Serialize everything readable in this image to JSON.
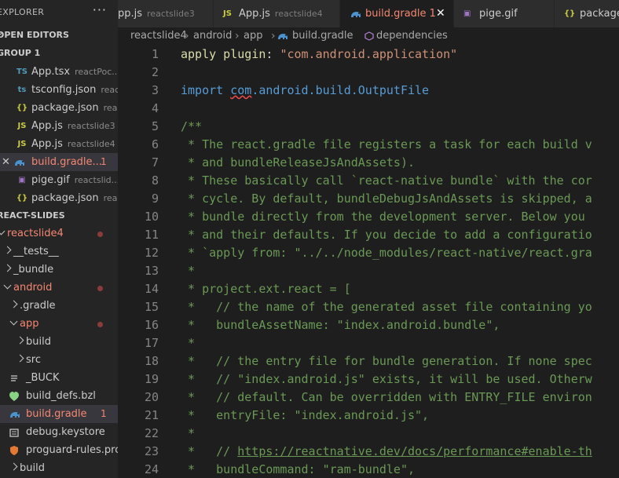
{
  "explorer": {
    "title": "EXPLORER",
    "more": "···",
    "open_editors_title": "OPEN EDITORS",
    "group_title": "GROUP 1",
    "open_editors": [
      {
        "label": "App.tsx",
        "desc": "reactPoc...",
        "icon": "typescript-icon",
        "glyph": "TS",
        "color": "#519aba"
      },
      {
        "label": "tsconfig.json",
        "desc": "reac...",
        "icon": "tsconfig-icon",
        "glyph": "ts",
        "color": "#519aba"
      },
      {
        "label": "package.json",
        "desc": "rea...",
        "icon": "json-icon",
        "glyph": "{}",
        "color": "#cbcb41"
      },
      {
        "label": "App.js",
        "desc": "reactslide3",
        "icon": "javascript-icon",
        "glyph": "JS",
        "color": "#cbcb41"
      },
      {
        "label": "App.js",
        "desc": "reactslide4",
        "icon": "javascript-icon",
        "glyph": "JS",
        "color": "#cbcb41"
      },
      {
        "label": "build.gradle...",
        "desc": "",
        "badge": "1",
        "icon": "gradle-icon",
        "glyph": "",
        "color": "#4c92cf",
        "active": true,
        "error": true
      },
      {
        "label": "pige.gif",
        "desc": "reactslid...",
        "icon": "image-icon",
        "glyph": "▣",
        "color": "#a074c4"
      },
      {
        "label": "package.json",
        "desc": "rea...",
        "icon": "json-icon",
        "glyph": "{}",
        "color": "#cbcb41"
      }
    ],
    "project_title": "REACT-SLIDES",
    "tree": [
      {
        "label": "reactslide4",
        "type": "folder",
        "open": true,
        "depth": 0,
        "error": true,
        "dot": true
      },
      {
        "label": "__tests__",
        "type": "folder",
        "open": false,
        "depth": 1
      },
      {
        "label": "_bundle",
        "type": "folder",
        "open": false,
        "depth": 1
      },
      {
        "label": "android",
        "type": "folder",
        "open": true,
        "depth": 1,
        "error": true,
        "dot": true
      },
      {
        "label": ".gradle",
        "type": "folder",
        "open": false,
        "depth": 2
      },
      {
        "label": "app",
        "type": "folder",
        "open": true,
        "depth": 2,
        "error": true,
        "dot": true
      },
      {
        "label": "build",
        "type": "folder",
        "open": false,
        "depth": 3
      },
      {
        "label": "src",
        "type": "folder",
        "open": false,
        "depth": 3
      },
      {
        "label": "_BUCK",
        "type": "file",
        "icon": "file-icon",
        "depth": 3
      },
      {
        "label": "build_defs.bzl",
        "type": "file",
        "icon": "bazel-icon",
        "depth": 3
      },
      {
        "label": "build.gradle",
        "type": "file",
        "icon": "gradle-icon",
        "depth": 3,
        "badge": "1",
        "active": true,
        "error": true
      },
      {
        "label": "debug.keystore",
        "type": "file",
        "icon": "keystore-icon",
        "depth": 3
      },
      {
        "label": "proguard-rules.pro",
        "type": "file",
        "icon": "proguard-icon",
        "depth": 3
      },
      {
        "label": "build",
        "type": "folder",
        "open": false,
        "depth": 2
      }
    ]
  },
  "tabs": [
    {
      "label": "App.js",
      "desc": "reactslide3",
      "icon": "javascript-icon",
      "glyph": "JS",
      "color": "#cbcb41",
      "partial_label": "pp.js"
    },
    {
      "label": "App.js",
      "desc": "reactslide4",
      "icon": "javascript-icon",
      "glyph": "JS",
      "color": "#cbcb41"
    },
    {
      "label": "build.gradle 1",
      "desc": "",
      "icon": "gradle-icon",
      "active": true,
      "close": "✕"
    },
    {
      "label": "pige.gif",
      "desc": "",
      "icon": "image-icon",
      "glyph": "▣",
      "color": "#a074c4"
    },
    {
      "label": "package.",
      "desc": "",
      "icon": "json-icon",
      "glyph": "{}",
      "color": "#cbcb41"
    }
  ],
  "breadcrumb": [
    "reactslide4",
    "android",
    "app",
    "build.gradle",
    "dependencies"
  ],
  "editor": {
    "lines": [
      {
        "n": 1,
        "tokens": [
          {
            "t": "apply plugin",
            "c": "id"
          },
          {
            "t": ": ",
            "c": "pl"
          },
          {
            "t": "\"com.android.application\"",
            "c": "str"
          }
        ]
      },
      {
        "n": 2,
        "tokens": []
      },
      {
        "n": 3,
        "tokens": [
          {
            "t": "import ",
            "c": "kw"
          },
          {
            "t": "com",
            "c": "kw squig"
          },
          {
            "t": ".android.build.OutputFile",
            "c": "kw"
          }
        ]
      },
      {
        "n": 4,
        "tokens": []
      },
      {
        "n": 5,
        "tokens": [
          {
            "t": "/**",
            "c": "cm"
          }
        ]
      },
      {
        "n": 6,
        "tokens": [
          {
            "t": " * The react.gradle file registers a task for each build v",
            "c": "cm"
          }
        ]
      },
      {
        "n": 7,
        "tokens": [
          {
            "t": " * and bundleReleaseJsAndAssets).",
            "c": "cm"
          }
        ]
      },
      {
        "n": 8,
        "tokens": [
          {
            "t": " * These basically call `react-native bundle` with the cor",
            "c": "cm"
          }
        ]
      },
      {
        "n": 9,
        "tokens": [
          {
            "t": " * cycle. By default, bundleDebugJsAndAssets is skipped, a",
            "c": "cm"
          }
        ]
      },
      {
        "n": 10,
        "tokens": [
          {
            "t": " * bundle directly from the development server. Below you ",
            "c": "cm"
          }
        ]
      },
      {
        "n": 11,
        "tokens": [
          {
            "t": " * and their defaults. If you decide to add a configuratio",
            "c": "cm"
          }
        ]
      },
      {
        "n": 12,
        "tokens": [
          {
            "t": " * `apply from: \"../../node_modules/react-native/react.gra",
            "c": "cm"
          }
        ]
      },
      {
        "n": 13,
        "tokens": [
          {
            "t": " *",
            "c": "cm"
          }
        ]
      },
      {
        "n": 14,
        "tokens": [
          {
            "t": " * project.ext.react = [",
            "c": "cm"
          }
        ]
      },
      {
        "n": 15,
        "tokens": [
          {
            "t": " *   // the name of the generated asset file containing yo",
            "c": "cm"
          }
        ]
      },
      {
        "n": 16,
        "tokens": [
          {
            "t": " *   bundleAssetName: \"index.android.bundle\",",
            "c": "cm"
          }
        ]
      },
      {
        "n": 17,
        "tokens": [
          {
            "t": " *",
            "c": "cm"
          }
        ]
      },
      {
        "n": 18,
        "tokens": [
          {
            "t": " *   // the entry file for bundle generation. If none spec",
            "c": "cm"
          }
        ]
      },
      {
        "n": 19,
        "tokens": [
          {
            "t": " *   // \"index.android.js\" exists, it will be used. Otherw",
            "c": "cm"
          }
        ]
      },
      {
        "n": 20,
        "tokens": [
          {
            "t": " *   // default. Can be overridden with ENTRY_FILE environ",
            "c": "cm"
          }
        ]
      },
      {
        "n": 21,
        "tokens": [
          {
            "t": " *   entryFile: \"index.android.js\",",
            "c": "cm"
          }
        ]
      },
      {
        "n": 22,
        "tokens": [
          {
            "t": " *",
            "c": "cm"
          }
        ]
      },
      {
        "n": 23,
        "tokens": [
          {
            "t": " *   // ",
            "c": "cm"
          },
          {
            "t": "https://reactnative.dev/docs/performance#enable-th",
            "c": "cm uline"
          }
        ]
      },
      {
        "n": 24,
        "tokens": [
          {
            "t": " *   bundleCommand: \"ram-bundle\",",
            "c": "cm"
          }
        ]
      }
    ]
  },
  "colors": {
    "error": "#f48771",
    "gradle": "#4c92cf",
    "javascript": "#cbcb41",
    "comment": "#6a9955",
    "string": "#ce9178",
    "keyword": "#569cd6"
  }
}
